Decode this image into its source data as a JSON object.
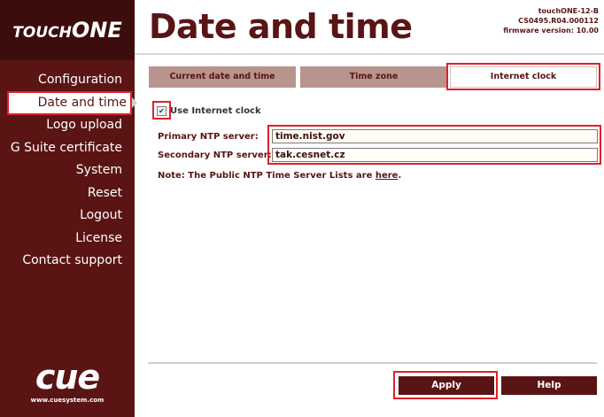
{
  "brand": {
    "logo_small": "TOUCH",
    "logo_big": "ONE",
    "cue": "cue",
    "cue_url": "www.cuesystem.com"
  },
  "header": {
    "title": "Date and time",
    "device_name": "touchONE-12-B",
    "device_serial": "CS0495.R04.000112",
    "firmware": "firmware version: 10.00"
  },
  "sidebar": {
    "items": [
      {
        "label": "Configuration"
      },
      {
        "label": "Date and time"
      },
      {
        "label": "Logo upload"
      },
      {
        "label": "G Suite certificate"
      },
      {
        "label": "System"
      },
      {
        "label": "Reset"
      },
      {
        "label": "Logout"
      },
      {
        "label": "License"
      },
      {
        "label": "Contact support"
      }
    ]
  },
  "tabs": [
    {
      "label": "Current date and time"
    },
    {
      "label": "Time zone"
    },
    {
      "label": "Internet clock"
    }
  ],
  "form": {
    "use_internet_clock_label": "Use Internet clock",
    "use_internet_clock_checked": true,
    "checkbox_mark": "✔",
    "primary_label": "Primary NTP server:",
    "primary_value": "time.nist.gov",
    "secondary_label": "Secondary NTP server:",
    "secondary_value": "tak.cesnet.cz",
    "note_text": "Note: The Public NTP Time Server Lists are ",
    "note_link": "here",
    "note_end": "."
  },
  "buttons": {
    "apply": "Apply",
    "help": "Help"
  },
  "colors": {
    "brand": "#5a1414",
    "tab_inactive": "#b8948f",
    "highlight": "#e01f2a"
  }
}
